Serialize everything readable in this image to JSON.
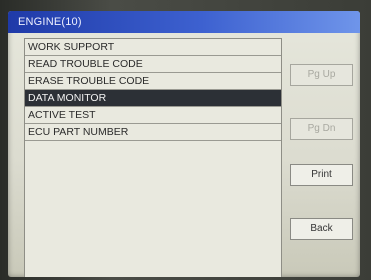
{
  "window": {
    "title": "ENGINE(10)"
  },
  "menu": {
    "items": [
      {
        "label": "WORK SUPPORT",
        "selected": false
      },
      {
        "label": "READ TROUBLE CODE",
        "selected": false
      },
      {
        "label": "ERASE TROUBLE CODE",
        "selected": false
      },
      {
        "label": "DATA MONITOR",
        "selected": true
      },
      {
        "label": "ACTIVE TEST",
        "selected": false
      },
      {
        "label": "ECU PART NUMBER",
        "selected": false
      }
    ]
  },
  "buttons": {
    "pg_up": {
      "label": "Pg Up",
      "enabled": false
    },
    "pg_dn": {
      "label": "Pg Dn",
      "enabled": false
    },
    "print": {
      "label": "Print",
      "enabled": true
    },
    "back": {
      "label": "Back",
      "enabled": true
    }
  },
  "colors": {
    "titlebar": "#2e4fc0",
    "selected_row": "#2c3036"
  }
}
